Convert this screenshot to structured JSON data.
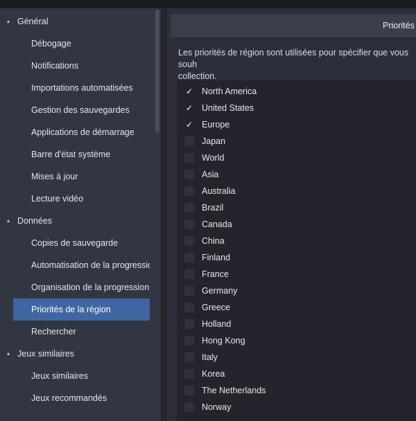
{
  "sidebar": {
    "rows": [
      {
        "type": "category",
        "label": "Général"
      },
      {
        "type": "item",
        "label": "Débogage"
      },
      {
        "type": "item",
        "label": "Notifications"
      },
      {
        "type": "item",
        "label": "Importations automatisées"
      },
      {
        "type": "item",
        "label": "Gestion des sauvegardes"
      },
      {
        "type": "item",
        "label": "Applications de démarrage"
      },
      {
        "type": "item",
        "label": "Barre d'état système"
      },
      {
        "type": "item",
        "label": "Mises à jour"
      },
      {
        "type": "item",
        "label": "Lecture vidéo"
      },
      {
        "type": "category",
        "label": "Données"
      },
      {
        "type": "item",
        "label": "Copies de sauvegarde"
      },
      {
        "type": "item",
        "label": "Automatisation de la progression"
      },
      {
        "type": "item",
        "label": "Organisation de la progression de"
      },
      {
        "type": "item",
        "label": "Priorités de la région",
        "selected": true
      },
      {
        "type": "item",
        "label": "Rechercher"
      },
      {
        "type": "category",
        "label": "Jeux similaires"
      },
      {
        "type": "item",
        "label": "Jeux similaires"
      },
      {
        "type": "item",
        "label": "Jeux recommandés"
      }
    ]
  },
  "main": {
    "title": "Priorités d",
    "description": "Les priorités de région sont utilisées pour spécifier que vous souh\ncollection.",
    "regions": [
      {
        "name": "North America",
        "checked": true
      },
      {
        "name": "United States",
        "checked": true
      },
      {
        "name": "Europe",
        "checked": true
      },
      {
        "name": "Japan",
        "checked": false
      },
      {
        "name": "World",
        "checked": false
      },
      {
        "name": "Asia",
        "checked": false
      },
      {
        "name": "Australia",
        "checked": false
      },
      {
        "name": "Brazil",
        "checked": false
      },
      {
        "name": "Canada",
        "checked": false
      },
      {
        "name": "China",
        "checked": false
      },
      {
        "name": "Finland",
        "checked": false
      },
      {
        "name": "France",
        "checked": false
      },
      {
        "name": "Germany",
        "checked": false
      },
      {
        "name": "Greece",
        "checked": false
      },
      {
        "name": "Holland",
        "checked": false
      },
      {
        "name": "Hong Kong",
        "checked": false
      },
      {
        "name": "Italy",
        "checked": false
      },
      {
        "name": "Korea",
        "checked": false
      },
      {
        "name": "The Netherlands",
        "checked": false
      },
      {
        "name": "Norway",
        "checked": false
      }
    ]
  },
  "icons": {
    "expanded": "▴",
    "check": "✓"
  }
}
